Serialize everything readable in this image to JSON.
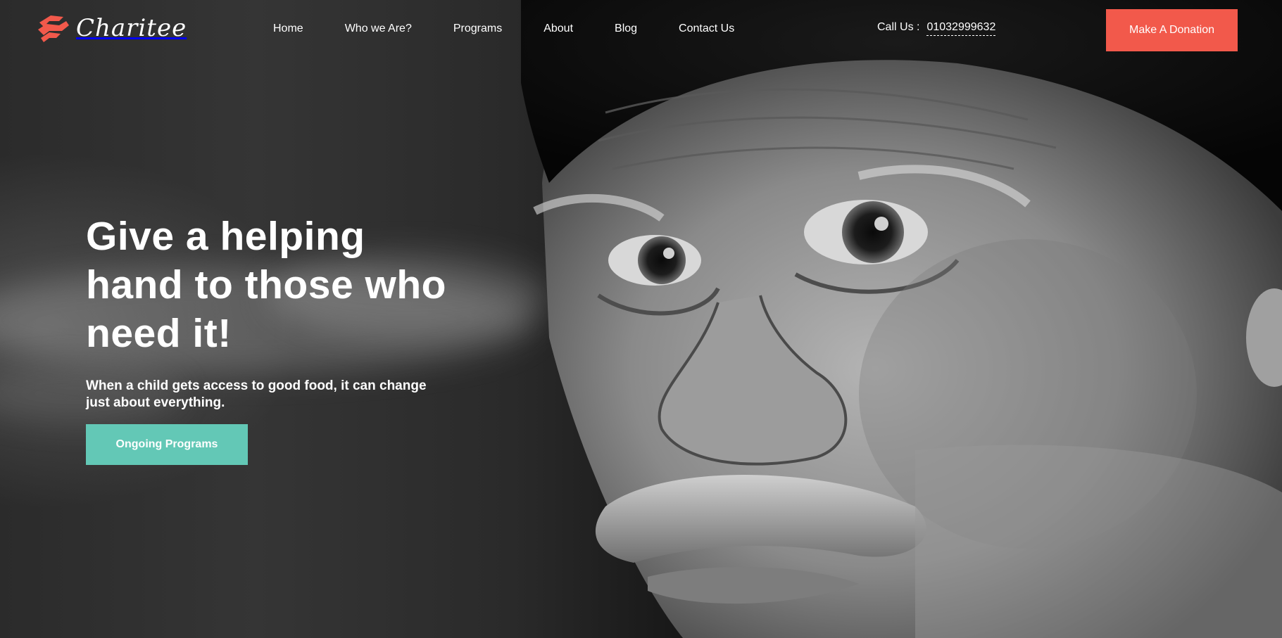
{
  "brand": {
    "name": "Charitee",
    "accent_color": "#f2594b",
    "logo_icon": "helping-hands-icon"
  },
  "nav": {
    "items": [
      {
        "label": "Home"
      },
      {
        "label": "Who we Are?"
      },
      {
        "label": "Programs"
      },
      {
        "label": "About"
      },
      {
        "label": "Blog"
      },
      {
        "label": "Contact Us"
      }
    ]
  },
  "contact": {
    "label": "Call Us :",
    "phone": "01032999632"
  },
  "header": {
    "donate_label": "Make A Donation"
  },
  "hero": {
    "headline": "Give a helping hand to those who need it!",
    "subline": "When a child gets access to good food, it can change just about everything.",
    "cta_label": "Ongoing Programs",
    "cta_color": "#63c8b6",
    "background_image": "black-and-white-portrait-of-elderly-man"
  }
}
